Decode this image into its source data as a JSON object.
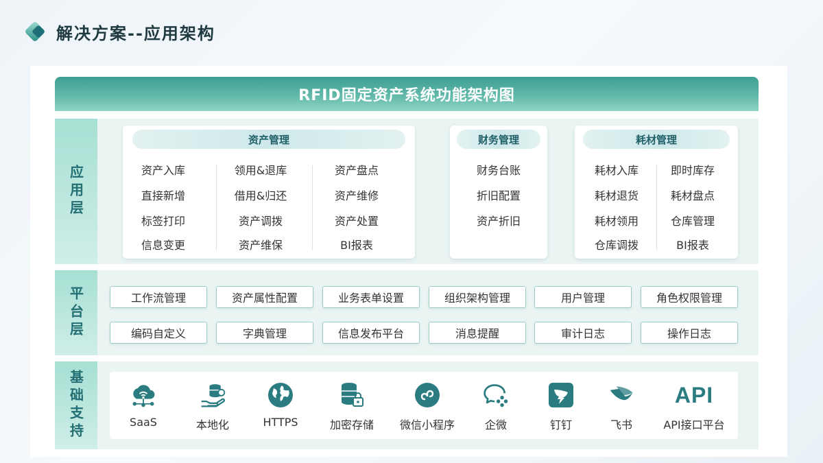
{
  "header": {
    "title": "解决方案--应用架构"
  },
  "diagram_title": "RFID固定资产系统功能架构图",
  "colors": {
    "primary": "#2a7c80",
    "banner": "#4fae9f",
    "layer_bg": "#eaf5f3"
  },
  "layers": {
    "application": {
      "label": "应用层",
      "asset_mgmt": {
        "title": "资产管理",
        "columns": [
          [
            "资产入库",
            "直接新增",
            "标签打印",
            "信息变更"
          ],
          [
            "领用&退库",
            "借用&归还",
            "资产调拨",
            "资产维保"
          ],
          [
            "资产盘点",
            "资产维修",
            "资产处置",
            "BI报表"
          ]
        ]
      },
      "finance_mgmt": {
        "title": "财务管理",
        "items": [
          "财务台账",
          "折旧配置",
          "资产折旧"
        ]
      },
      "consumables_mgmt": {
        "title": "耗材管理",
        "columns": [
          [
            "耗材入库",
            "耗材退货",
            "耗材领用",
            "仓库调拨"
          ],
          [
            "即时库存",
            "耗材盘点",
            "仓库管理",
            "BI报表"
          ]
        ]
      }
    },
    "platform": {
      "label": "平台层",
      "rows": [
        [
          "工作流管理",
          "资产属性配置",
          "业务表单设置",
          "组织架构管理",
          "用户管理",
          "角色权限管理"
        ],
        [
          "编码自定义",
          "字典管理",
          "信息发布平台",
          "消息提醒",
          "审计日志",
          "操作日志"
        ]
      ]
    },
    "infrastructure": {
      "label": "基础支持",
      "items": [
        {
          "label": "SaaS",
          "icon": "cloud-network-icon"
        },
        {
          "label": "本地化",
          "icon": "local-server-icon"
        },
        {
          "label": "HTTPS",
          "icon": "globe-icon"
        },
        {
          "label": "加密存储",
          "icon": "encrypted-database-icon"
        },
        {
          "label": "微信小程序",
          "icon": "wechat-mini-program-icon"
        },
        {
          "label": "企微",
          "icon": "wecom-icon"
        },
        {
          "label": "钉钉",
          "icon": "dingtalk-icon"
        },
        {
          "label": "飞书",
          "icon": "feishu-icon"
        },
        {
          "label": "API接口平台",
          "icon": "api-text-icon",
          "icon_text": "API"
        }
      ]
    }
  }
}
